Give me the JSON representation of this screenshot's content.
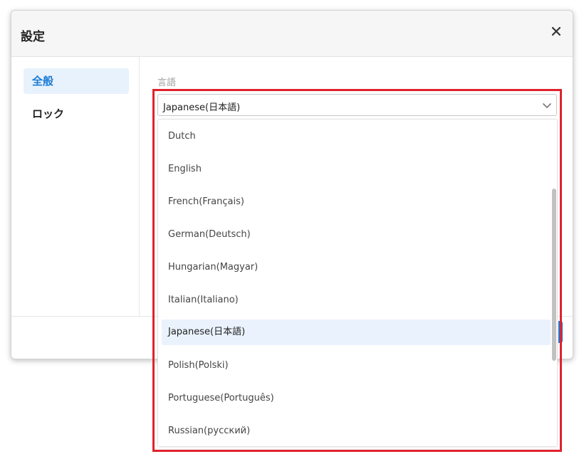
{
  "dialog": {
    "title": "設定",
    "close_icon": "close-icon"
  },
  "sidebar": {
    "items": [
      {
        "label": "全般",
        "active": true
      },
      {
        "label": "ロック",
        "active": false
      }
    ]
  },
  "language": {
    "label": "言語",
    "selected": "Japanese(日本語)",
    "options": [
      "Dutch",
      "English",
      "French(Français)",
      "German(Deutsch)",
      "Hungarian(Magyar)",
      "Italian(Italiano)",
      "Japanese(日本語)",
      "Polish(Polski)",
      "Portuguese(Português)",
      "Russian(русский)"
    ]
  },
  "colors": {
    "accent": "#1b7bd6",
    "highlight": "#e0222e",
    "selected_bg": "#eaf3fd"
  }
}
